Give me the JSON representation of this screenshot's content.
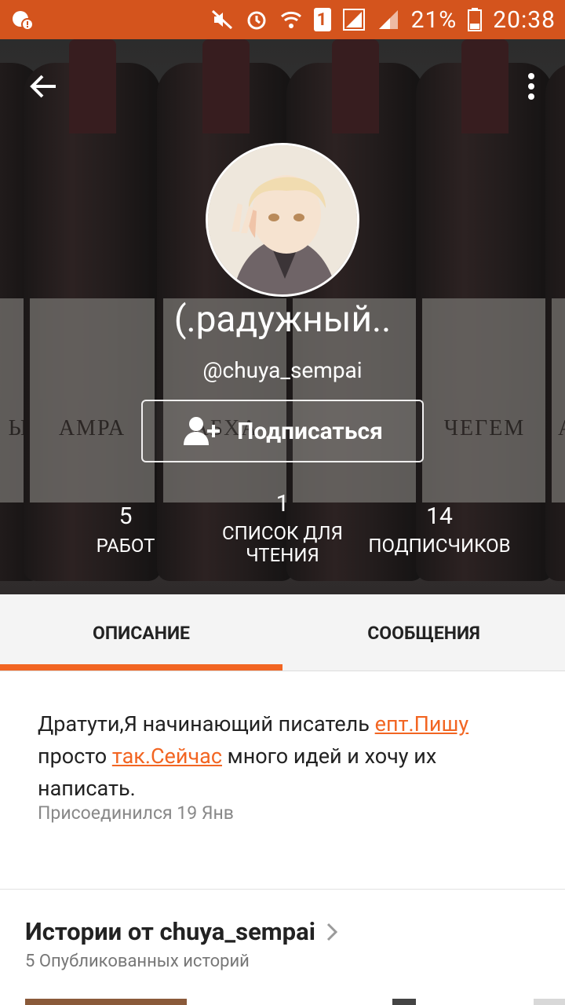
{
  "status_bar": {
    "battery": "21%",
    "time": "20:38",
    "sim": "1"
  },
  "hero": {
    "bottle_labels": [
      "Ы",
      "АМРА",
      "АБХА",
      "ЧЕГЕМ",
      "А"
    ]
  },
  "profile": {
    "display_name": "(.радужный..",
    "username": "@chuya_sempai",
    "follow_label": "Подписаться"
  },
  "stats": [
    {
      "value": "5",
      "label": "РАБОТ"
    },
    {
      "value": "1",
      "label": "СПИСОК ДЛЯ ЧТЕНИЯ"
    },
    {
      "value": "14",
      "label": "ПОДПИСЧИКОВ"
    }
  ],
  "tabs": {
    "description": "ОПИСАНИЕ",
    "messages": "СООБЩЕНИЯ"
  },
  "about": {
    "text_1": "Дратути,Я начинающий писатель ",
    "link_1": "епт.Пишу",
    "text_2": " просто ",
    "link_2": "так.Сейчас",
    "text_3": " много идей и хочу их написать.",
    "joined": "Присоединился 19 Янв"
  },
  "stories": {
    "title": "Истории от chuya_sempai",
    "subtitle": "5 Опубликованных историй"
  },
  "colors": {
    "accent": "#f26522",
    "status_bar": "#d4541d"
  }
}
